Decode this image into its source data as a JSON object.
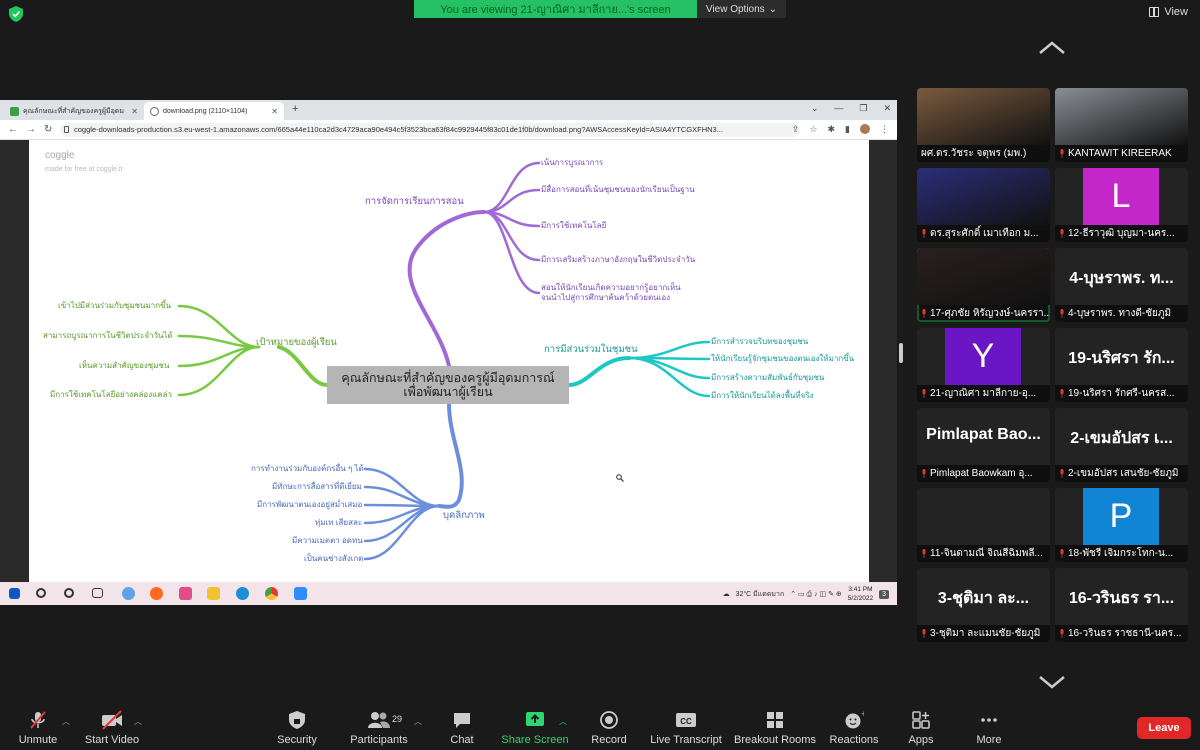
{
  "banner": {
    "text": "You are viewing 21-ญาณิศา มาลีกาย...'s screen",
    "view_options": "View Options",
    "view": "View"
  },
  "browser": {
    "tabs": [
      {
        "title": "คุณลักษณะที่สำคัญของครูผู้มีอุดมการ..."
      },
      {
        "title": "download.png (2110×1104)"
      }
    ],
    "url": "coggle-downloads-production.s3.eu-west-1.amazonaws.com/665a44e110ca2d3c4729aca90e494c5f3523bca63f84c9929445f83c01de1f0b/download.png?AWSAccessKeyId=ASIA4YTCGXFHN3..."
  },
  "mindmap": {
    "logo": "coggle",
    "sublogo": "made for free at coggle.it",
    "center_line1": "คุณลักษณะที่สำคัญของครูผู้มีอุดมการณ์",
    "center_line2": "เพื่อพัฒนาผู้เรียน",
    "top": {
      "label": "การจัดการเรียนการสอน",
      "color": "#a06ad6",
      "children": [
        "เน้นการบูรณาการ",
        "มีสื่อการสอนที่เน้นชุมชนของนักเรียนเป็นฐาน",
        "มีการใช้เทคโนโลยี",
        "มีการเสริมสร้างภาษาอังกฤษในชีวิตประจำวัน",
        "สอนให้นักเรียนเกิดความอยากรู้อยากเห็น",
        "จนนำไปสู่การศึกษาค้นคว้าด้วยตนเอง"
      ]
    },
    "left": {
      "label": "เป้าหมายของผู้เรียน",
      "color": "#7ac943",
      "children": [
        "เข้าไปมีส่วนร่วมกับชุมชนมากขึ้น",
        "สามารถบูรณาการในชีวิตประจำวันได้",
        "เห็นความสำคัญของชุมชน",
        "มีการใช้เทคโนโลยีอย่างคล่องแคล่ว"
      ]
    },
    "right": {
      "label": "การมีส่วนร่วมในชุมชน",
      "color": "#1ec6c6",
      "children": [
        "มีการสำรวจบริบทของชุมชน",
        "ให้นักเรียนรู้จักชุมชนของตนเองให้มากขึ้น",
        "มีการสร้างความสัมพันธ์กับชุมชน",
        "มีการให้นักเรียนได้ลงพื้นที่จริง"
      ]
    },
    "bottom": {
      "label": "บุคลิกภาพ",
      "color": "#6c8fdc",
      "children": [
        "การทำงานร่วมกับองค์กรอื่น ๆ ได้",
        "มีทักษะการสื่อสารที่ดีเยี่ยม",
        "มีการพัฒนาตนเองอยู่สม่ำเสมอ",
        "ทุ่มเท เสียสละ",
        "มีความเมตตา อดทน",
        "เป็นคนช่างสังเกต"
      ]
    }
  },
  "taskbar": {
    "weather": "32°C มีแดดมาก",
    "time": "3:41 PM",
    "date": "5/2/2022",
    "notif": "3"
  },
  "participants": [
    {
      "name": "ผศ.ดร.วัชระ จตุพร (มพ.)",
      "muted": false,
      "kind": "video",
      "bg": "#7a5a3e"
    },
    {
      "name": "KANTAWIT KIREERAK",
      "muted": true,
      "kind": "video",
      "bg": "#8a8f96"
    },
    {
      "name": "ดร.สุระศักดิ์ เมาเทือก ม...",
      "muted": true,
      "kind": "video",
      "bg": "#2b2e7a"
    },
    {
      "name": "12-ธีราวุฒิ บุญมา-นคร...",
      "muted": true,
      "kind": "letter",
      "letter": "L",
      "bg": "#c326c9"
    },
    {
      "name": "17-ศุภชัย หิรัญวงษ์-นครรา...",
      "muted": true,
      "kind": "video",
      "bg": "#2a1f1f",
      "active": true
    },
    {
      "name": "4-บุษราพร. ทางดี-ชัยภูมิ",
      "muted": true,
      "kind": "text",
      "big": "4-บุษราพร. ท..."
    },
    {
      "name": "21-ญาณิศา มาลีกาย-อุ...",
      "muted": true,
      "kind": "letter",
      "letter": "Y",
      "bg": "#6a16c4"
    },
    {
      "name": "19-นริศรา รักศรี-นครส...",
      "muted": true,
      "kind": "text",
      "big": "19-นริศรา รัก..."
    },
    {
      "name": "Pimlapat Baowkam อุ...",
      "muted": true,
      "kind": "text",
      "big": "Pimlapat Bao..."
    },
    {
      "name": "2-เขมอัปสร เสนชัย-ชัยภูมิ",
      "muted": true,
      "kind": "text",
      "big": "2-เขมอัปสร เ..."
    },
    {
      "name": "11-จินดามณี จิณสีฉิมพลี...",
      "muted": true,
      "kind": "blank"
    },
    {
      "name": "18-พัชรี เจิมกระโทก-น...",
      "muted": true,
      "kind": "letter",
      "letter": "P",
      "bg": "#1284d6"
    },
    {
      "name": "3-ชุติมา ละแมนชัย-ชัยภูมิ",
      "muted": true,
      "kind": "text",
      "big": "3-ชุติมา ละ..."
    },
    {
      "name": "16-วรินธร ราชธานี-นคร...",
      "muted": true,
      "kind": "text",
      "big": "16-วรินธร รา..."
    }
  ],
  "toolbar": {
    "unmute": "Unmute",
    "start_video": "Start Video",
    "security": "Security",
    "participants": "Participants",
    "participants_count": "29",
    "chat": "Chat",
    "share_screen": "Share Screen",
    "record": "Record",
    "live_transcript": "Live Transcript",
    "breakout": "Breakout Rooms",
    "reactions": "Reactions",
    "apps": "Apps",
    "more": "More",
    "leave": "Leave"
  },
  "colors": {
    "banner": "#25c164",
    "leave": "#e02828",
    "active_border": "#22c55e"
  }
}
